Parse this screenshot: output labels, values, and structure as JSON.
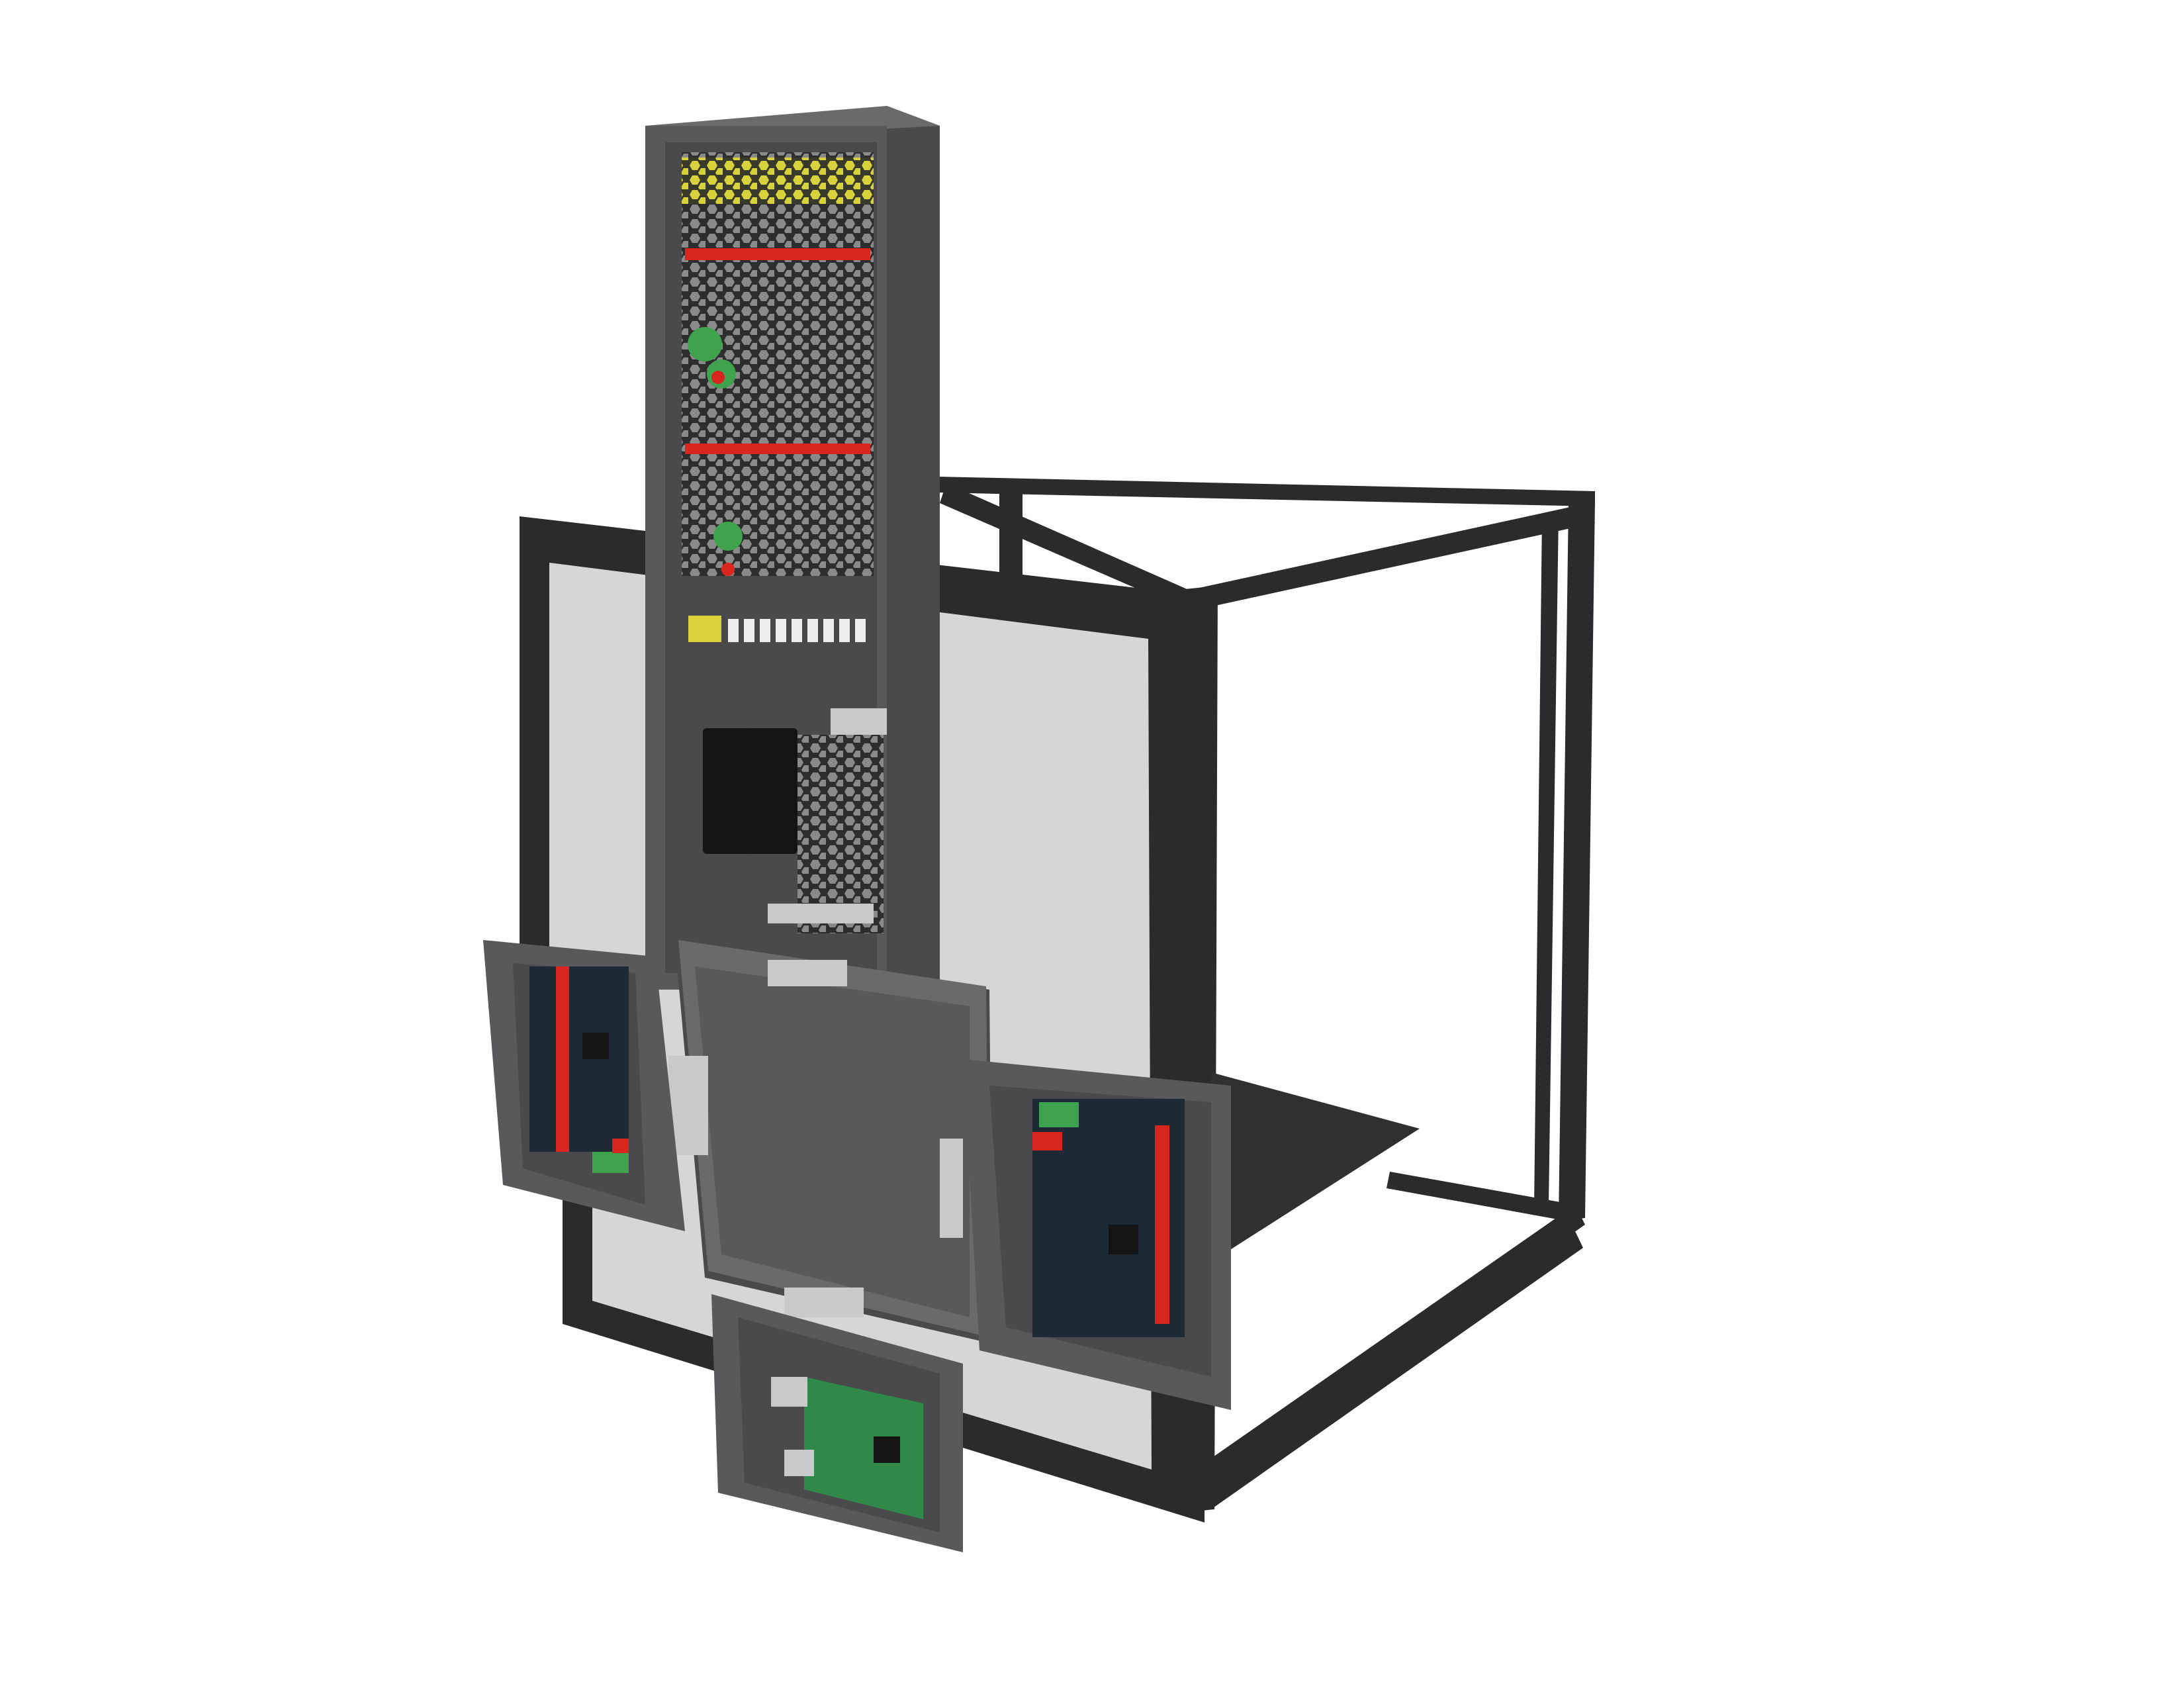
{
  "scene": {
    "subject": "printer-frame-with-electronics-enclosures",
    "colors": {
      "background": "#ffffff",
      "frame": "#2b2b2d",
      "frame_edge": "#3d3d40",
      "panel": "#d6d6d8",
      "enclosure": "#59595b",
      "enclosure_inner": "#4a4a4c",
      "enclosure_rim": "#6a6a6c",
      "psu_mesh": "#8c8c8c",
      "pcb_dark": "#1d2a33",
      "pcb_green": "#2f8a4a",
      "driver_red": "#d8261f",
      "terminal_green": "#3fa34d",
      "terminal_yellow": "#d9d23a",
      "plastic_clip": "#c9c9cc",
      "relay_black": "#141414",
      "bed": "#303033"
    }
  }
}
